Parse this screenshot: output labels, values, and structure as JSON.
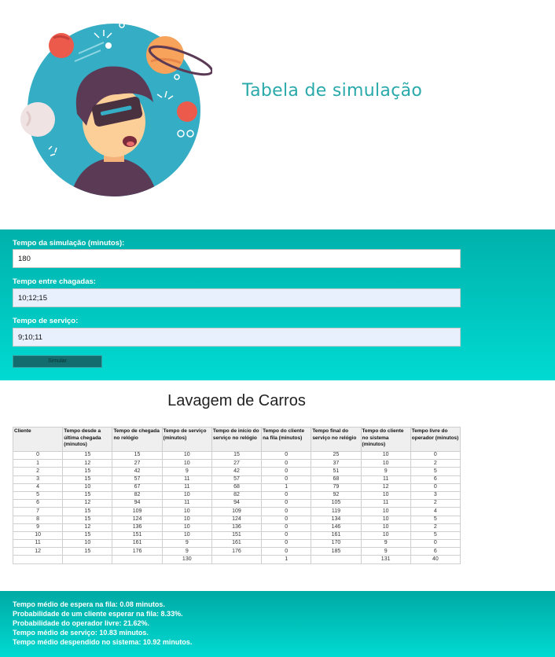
{
  "header": {
    "title": "Tabela de simulação"
  },
  "form": {
    "sim_time_label": "Tempo da simulação (minutos):",
    "sim_time_value": "180",
    "arrival_label": "Tempo entre chagadas:",
    "arrival_value": "10;12;15",
    "service_label": "Tempo de serviço:",
    "service_value": "9;10;11",
    "button_label": "Simular"
  },
  "table": {
    "title": "Lavagem de Carros",
    "headers": [
      "Cliente",
      "Tempo desde a última chegada (minutos)",
      "Tempo de chegada no relógio",
      "Tempo de serviço (minutos)",
      "Tempo de início do serviço no relógio",
      "Tempo do cliente na fila (minutos)",
      "Tempo final do serviço no relógio",
      "Tempo do cliente no sistema (minutos)",
      "Tempo livre do operador (minutos)"
    ],
    "rows": [
      [
        "0",
        "15",
        "15",
        "10",
        "15",
        "0",
        "25",
        "10",
        "0"
      ],
      [
        "1",
        "12",
        "27",
        "10",
        "27",
        "0",
        "37",
        "10",
        "2"
      ],
      [
        "2",
        "15",
        "42",
        "9",
        "42",
        "0",
        "51",
        "9",
        "5"
      ],
      [
        "3",
        "15",
        "57",
        "11",
        "57",
        "0",
        "68",
        "11",
        "6"
      ],
      [
        "4",
        "10",
        "67",
        "11",
        "68",
        "1",
        "79",
        "12",
        "0"
      ],
      [
        "5",
        "15",
        "82",
        "10",
        "82",
        "0",
        "92",
        "10",
        "3"
      ],
      [
        "6",
        "12",
        "94",
        "11",
        "94",
        "0",
        "105",
        "11",
        "2"
      ],
      [
        "7",
        "15",
        "109",
        "10",
        "109",
        "0",
        "119",
        "10",
        "4"
      ],
      [
        "8",
        "15",
        "124",
        "10",
        "124",
        "0",
        "134",
        "10",
        "5"
      ],
      [
        "9",
        "12",
        "136",
        "10",
        "136",
        "0",
        "146",
        "10",
        "2"
      ],
      [
        "10",
        "15",
        "151",
        "10",
        "151",
        "0",
        "161",
        "10",
        "5"
      ],
      [
        "11",
        "10",
        "161",
        "9",
        "161",
        "0",
        "170",
        "9",
        "0"
      ],
      [
        "12",
        "15",
        "176",
        "9",
        "176",
        "0",
        "185",
        "9",
        "6"
      ]
    ],
    "totals": [
      "",
      "",
      "",
      "130",
      "",
      "1",
      "",
      "131",
      "40"
    ]
  },
  "stats": [
    "Tempo médio de espera na fila: 0.08 minutos.",
    "Probabilidade de um cliente esperar na fila: 8.33%.",
    "Probabilidade do operador livre: 21.62%.",
    "Tempo médio de serviço: 10.83 minutos.",
    "Tempo médio despendido no sistema: 10.92 minutos."
  ],
  "colors": {
    "accent": "#2aa9aa",
    "teal_dark": "#00b1ab",
    "teal_light": "#00dad2",
    "button": "#136c6d"
  }
}
